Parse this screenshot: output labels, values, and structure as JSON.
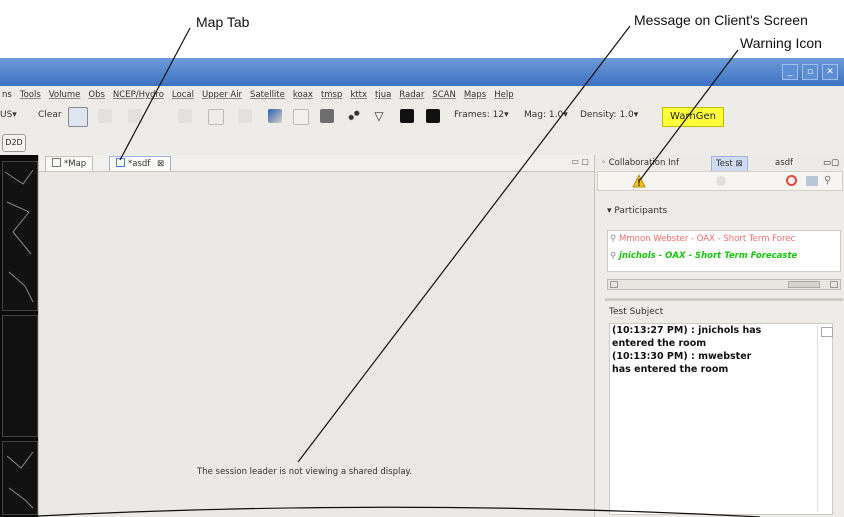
{
  "callouts": {
    "map_tab": "Map Tab",
    "message": "Message on Client's Screen",
    "warning": "Warning Icon"
  },
  "menubar": [
    "ns",
    "Tools",
    "Volume",
    "Obs",
    "NCEP/Hydro",
    "Local",
    "Upper Air",
    "Satellite",
    "koax",
    "tmsp",
    "kttx",
    "tjua",
    "Radar",
    "SCAN",
    "Maps",
    "Help"
  ],
  "toolbar": {
    "us": "US▾",
    "clear": "Clear",
    "frames": "Frames: 12▾",
    "mag": "Mag: 1.0▾",
    "density": "Density: 1.0▾",
    "warngen": "WarnGen"
  },
  "row3": {
    "d2d": "D2D"
  },
  "editor": {
    "tab_map": "*Map",
    "tab_asdf": "*asdf",
    "tab_close": "⊠",
    "message": "The session leader is not viewing a shared display."
  },
  "right": {
    "tab_collab": "Collaboration Inf",
    "tab_test": "Test",
    "tab_asdf": "asdf",
    "participants_label": "▾ Participants",
    "participants": [
      {
        "text": "Mmnon Webster - OAX - Short Term Forec",
        "color": "#ff6b6b"
      },
      {
        "text": "jnichols - OAX - Short Term Forecaste",
        "color": "#16c60c"
      }
    ],
    "subject": "Test Subject",
    "chat": [
      "(10:13:27 PM) : jnichols has",
      "entered the room",
      "(10:13:30 PM) : mwebster",
      "has entered the room"
    ]
  },
  "colors": {
    "titlebar": "#4a7fcb",
    "warngen_bg": "#ffff3a",
    "participant_leader": "#ff6b6b",
    "participant_self": "#16c60c"
  }
}
